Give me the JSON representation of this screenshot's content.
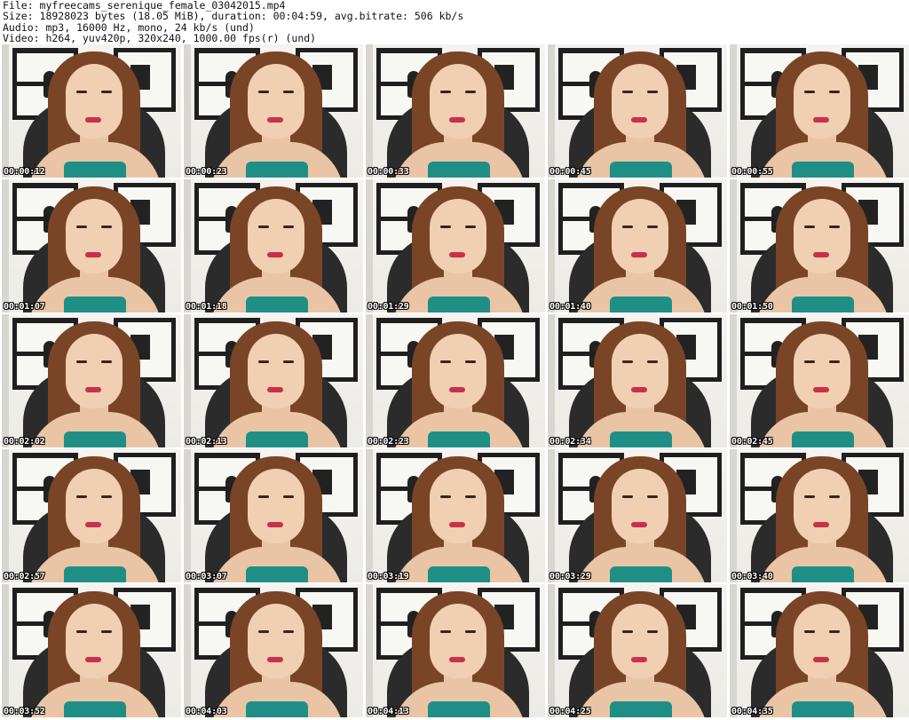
{
  "header": {
    "file": "File: myfreecams_serenique_female_03042015.mp4",
    "size": "Size: 18928023 bytes (18.05 MiB), duration: 00:04:59, avg.bitrate: 506 kb/s",
    "audio": "Audio: mp3, 16000 Hz, mono, 24 kb/s (und)",
    "video": "Video: h264, yuv420p, 320x240, 1000.00 fps(r) (und)"
  },
  "thumbnails": [
    {
      "timestamp": "00:00:12"
    },
    {
      "timestamp": "00:00:23"
    },
    {
      "timestamp": "00:00:33"
    },
    {
      "timestamp": "00:00:45"
    },
    {
      "timestamp": "00:00:55"
    },
    {
      "timestamp": "00:01:07"
    },
    {
      "timestamp": "00:01:18"
    },
    {
      "timestamp": "00:01:29"
    },
    {
      "timestamp": "00:01:40"
    },
    {
      "timestamp": "00:01:50"
    },
    {
      "timestamp": "00:02:02"
    },
    {
      "timestamp": "00:02:13"
    },
    {
      "timestamp": "00:02:23"
    },
    {
      "timestamp": "00:02:34"
    },
    {
      "timestamp": "00:02:45"
    },
    {
      "timestamp": "00:02:57"
    },
    {
      "timestamp": "00:03:07"
    },
    {
      "timestamp": "00:03:19"
    },
    {
      "timestamp": "00:03:29"
    },
    {
      "timestamp": "00:03:40"
    },
    {
      "timestamp": "00:03:52"
    },
    {
      "timestamp": "00:04:03"
    },
    {
      "timestamp": "00:04:13"
    },
    {
      "timestamp": "00:04:25"
    },
    {
      "timestamp": "00:04:35"
    }
  ]
}
